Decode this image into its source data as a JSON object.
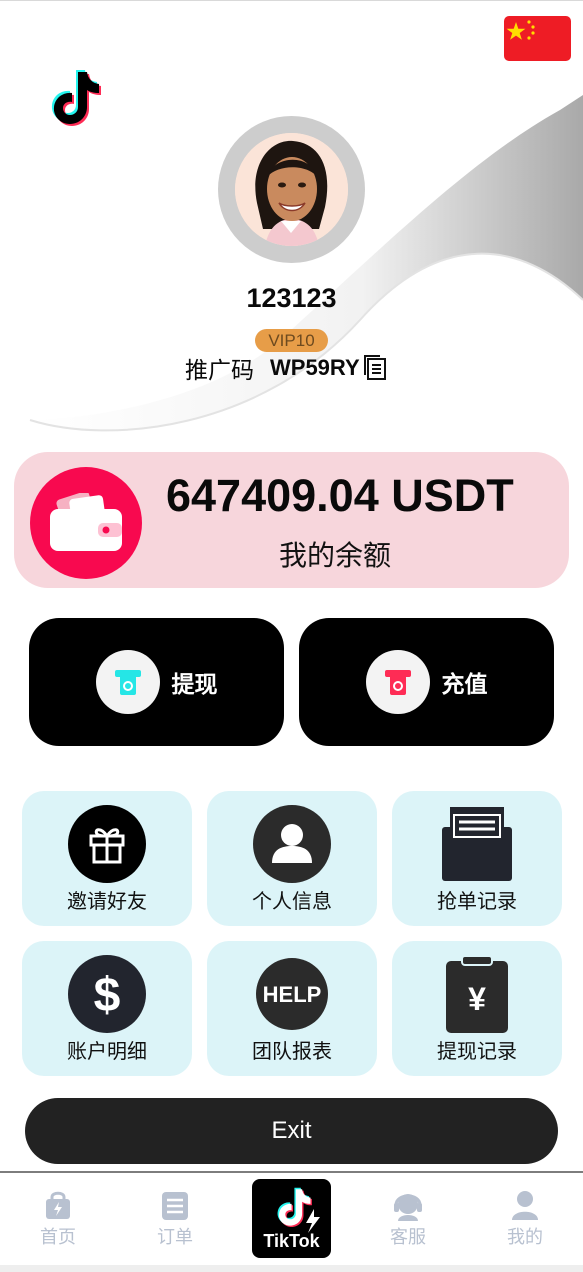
{
  "profile": {
    "username": "123123",
    "vip_level": "VIP10",
    "promo_label": "推广码",
    "promo_code": "WP59RY"
  },
  "balance": {
    "amount": "647409.04 USDT",
    "label": "我的余额"
  },
  "actions": {
    "withdraw_label": "提现",
    "recharge_label": "充值"
  },
  "menu": [
    {
      "label": "邀请好友",
      "icon": "gift-icon"
    },
    {
      "label": "个人信息",
      "icon": "person-icon"
    },
    {
      "label": "抢单记录",
      "icon": "order-box-icon"
    },
    {
      "label": "账户明细",
      "icon": "dollar-icon"
    },
    {
      "label": "团队报表",
      "icon": "help-icon"
    },
    {
      "label": "提现记录",
      "icon": "yen-clipboard-icon"
    }
  ],
  "exit_label": "Exit",
  "nav": {
    "home": "首页",
    "orders": "订单",
    "center_brand": "TikTok",
    "service": "客服",
    "mine": "我的"
  },
  "colors": {
    "balance_card": "#f7d6dc",
    "wallet_accent": "#f8094f",
    "vip_badge": "#e79d48",
    "tile_bg": "#dcf4f8",
    "nav_inactive": "#b8c1d0"
  }
}
